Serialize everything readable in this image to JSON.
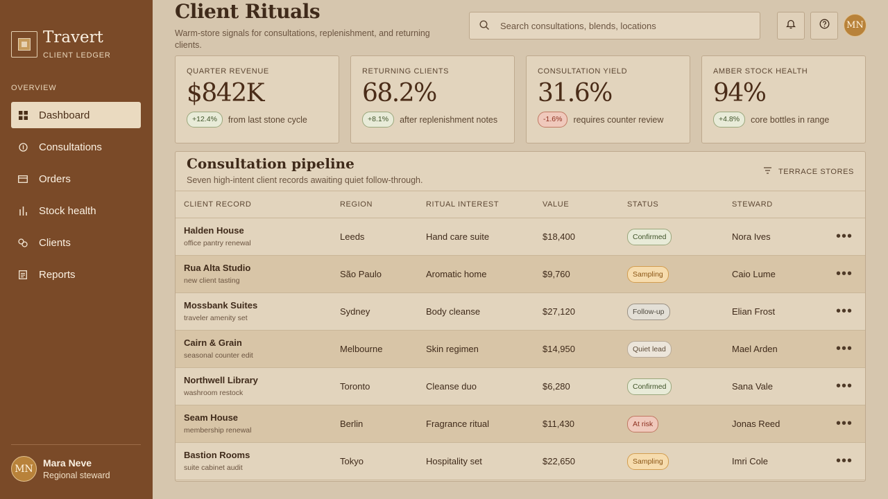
{
  "sidebar": {
    "brand_name": "Travert",
    "brand_sub": "CLIENT LEDGER",
    "section": "OVERVIEW",
    "items": [
      {
        "label": "Dashboard",
        "icon": "grid-icon",
        "active": true
      },
      {
        "label": "Consultations",
        "icon": "circle-line-icon"
      },
      {
        "label": "Orders",
        "icon": "card-icon"
      },
      {
        "label": "Stock health",
        "icon": "bars-icon"
      },
      {
        "label": "Clients",
        "icon": "link-icon"
      },
      {
        "label": "Reports",
        "icon": "report-icon"
      }
    ],
    "user": {
      "initials": "MN",
      "name": "Mara Neve",
      "role": "Regional steward"
    }
  },
  "header": {
    "title": "Client Rituals",
    "subtitle": "Warm-store signals for consultations, replenishment, and returning clients.",
    "search_placeholder": "Search consultations, blends, locations",
    "avatar_initials": "MN"
  },
  "kpis": [
    {
      "label": "QUARTER REVENUE",
      "value": "$842K",
      "delta": "+12.4%",
      "trend": "pos",
      "note": "from last stone cycle"
    },
    {
      "label": "RETURNING CLIENTS",
      "value": "68.2%",
      "delta": "+8.1%",
      "trend": "pos",
      "note": "after replenishment notes"
    },
    {
      "label": "CONSULTATION YIELD",
      "value": "31.6%",
      "delta": "-1.6%",
      "trend": "neg",
      "note": "requires counter review"
    },
    {
      "label": "AMBER STOCK HEALTH",
      "value": "94%",
      "delta": "+4.8%",
      "trend": "pos",
      "note": "core bottles in range"
    }
  ],
  "pipeline": {
    "title": "Consultation pipeline",
    "subtitle": "Seven high-intent client records awaiting quiet follow-through.",
    "filter": "TERRACE STORES",
    "columns": [
      "CLIENT RECORD",
      "REGION",
      "RITUAL INTEREST",
      "VALUE",
      "STATUS",
      "STEWARD"
    ],
    "rows": [
      {
        "client": "Halden House",
        "note": "office pantry renewal",
        "region": "Leeds",
        "interest": "Hand care suite",
        "value": "$18,400",
        "status": "Confirmed",
        "status_kind": "confirmed",
        "steward": "Nora Ives"
      },
      {
        "client": "Rua Alta Studio",
        "note": "new client tasting",
        "region": "São Paulo",
        "interest": "Aromatic home",
        "value": "$9,760",
        "status": "Sampling",
        "status_kind": "sampling",
        "steward": "Caio Lume"
      },
      {
        "client": "Mossbank Suites",
        "note": "traveler amenity set",
        "region": "Sydney",
        "interest": "Body cleanse",
        "value": "$27,120",
        "status": "Follow-up",
        "status_kind": "follow",
        "steward": "Elian Frost"
      },
      {
        "client": "Cairn & Grain",
        "note": "seasonal counter edit",
        "region": "Melbourne",
        "interest": "Skin regimen",
        "value": "$14,950",
        "status": "Quiet lead",
        "status_kind": "quiet",
        "steward": "Mael Arden"
      },
      {
        "client": "Northwell Library",
        "note": "washroom restock",
        "region": "Toronto",
        "interest": "Cleanse duo",
        "value": "$6,280",
        "status": "Confirmed",
        "status_kind": "confirmed",
        "steward": "Sana Vale"
      },
      {
        "client": "Seam House",
        "note": "membership renewal",
        "region": "Berlin",
        "interest": "Fragrance ritual",
        "value": "$11,430",
        "status": "At risk",
        "status_kind": "risk",
        "steward": "Jonas Reed"
      },
      {
        "client": "Bastion Rooms",
        "note": "suite cabinet audit",
        "region": "Tokyo",
        "interest": "Hospitality set",
        "value": "$22,650",
        "status": "Sampling",
        "status_kind": "sampling",
        "steward": "Imri Cole"
      }
    ],
    "row_action": "•••"
  },
  "colors": {
    "sidebar": "#7a4a28",
    "background": "#d6c6ae",
    "accent_avatar": "#b8823a",
    "positive": "#3f5328",
    "negative": "#8c2f1e"
  }
}
